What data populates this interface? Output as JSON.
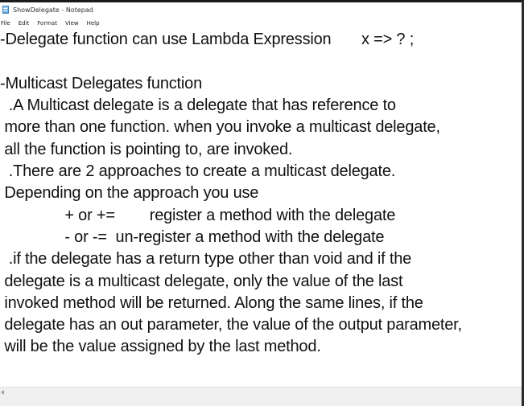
{
  "window": {
    "title": "ShowDelegate - Notepad"
  },
  "menu": [
    "File",
    "Edit",
    "Format",
    "View",
    "Help"
  ],
  "editor": {
    "lines": [
      "-Delegate function can use Lambda Expression       x => ? ;",
      "",
      "-Multicast Delegates function",
      "  .A Multicast delegate is a delegate that has reference to",
      " more than one function. when you invoke a multicast delegate,",
      " all the function is pointing to, are invoked.",
      "  .There are 2 approaches to create a multicast delegate.",
      " Depending on the approach you use",
      "               + or +=        register a method with the delegate",
      "               - or -=  un-register a method with the delegate",
      "  .if the delegate has a return type other than void and if the",
      " delegate is a multicast delegate, only the value of the last",
      " invoked method will be returned. Along the same lines, if the",
      " delegate has an out parameter, the value of the output parameter,",
      " will be the value assigned by the last method."
    ]
  },
  "icons": {
    "app": "notepad-icon",
    "scroll_left": "scroll-left-arrow-icon"
  }
}
